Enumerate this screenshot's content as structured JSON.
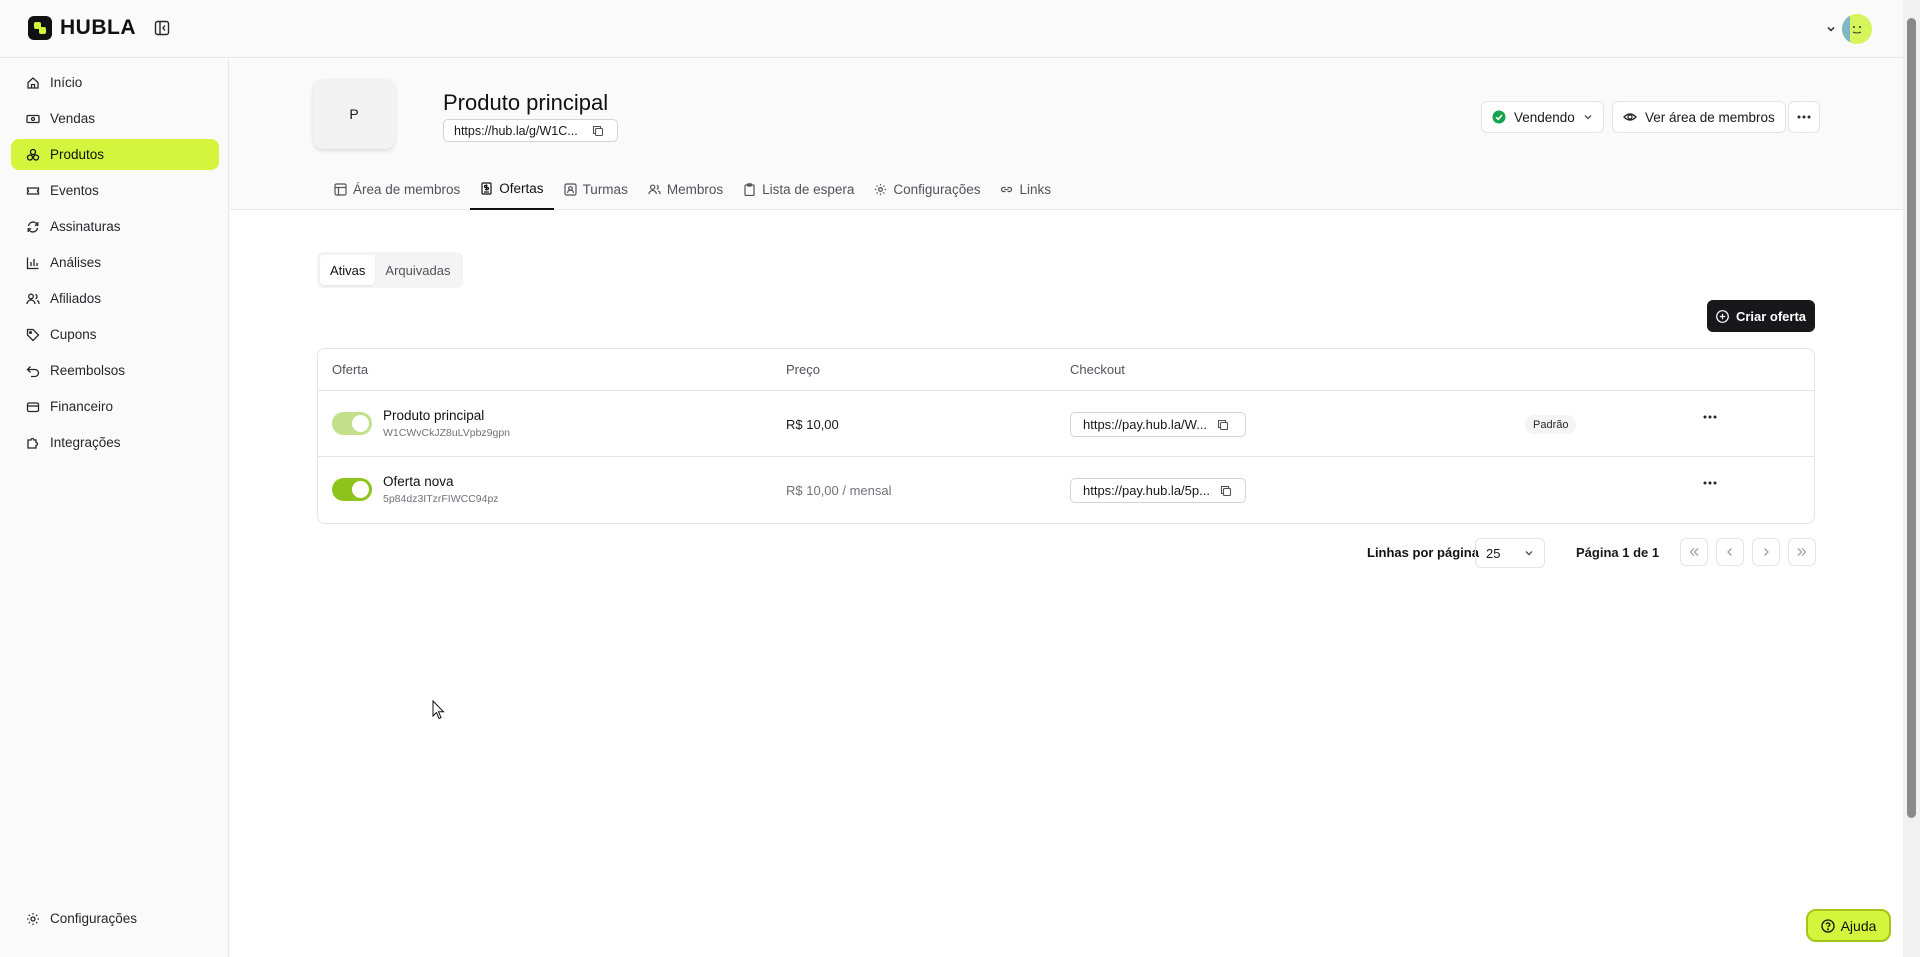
{
  "brand": {
    "name": "HUBLA",
    "accent": "#d4f53c"
  },
  "sidebar": {
    "items": [
      {
        "label": "Início",
        "icon": "home-icon"
      },
      {
        "label": "Vendas",
        "icon": "cash-icon"
      },
      {
        "label": "Produtos",
        "icon": "box-icon",
        "active": true
      },
      {
        "label": "Eventos",
        "icon": "ticket-icon"
      },
      {
        "label": "Assinaturas",
        "icon": "refresh-icon"
      },
      {
        "label": "Análises",
        "icon": "bar-chart-icon"
      },
      {
        "label": "Afiliados",
        "icon": "users-icon"
      },
      {
        "label": "Cupons",
        "icon": "tag-icon"
      },
      {
        "label": "Reembolsos",
        "icon": "undo-icon"
      },
      {
        "label": "Financeiro",
        "icon": "wallet-icon"
      },
      {
        "label": "Integrações",
        "icon": "puzzle-icon"
      }
    ],
    "footer_label": "Configurações"
  },
  "product": {
    "initial": "P",
    "title": "Produto principal",
    "link": "https://hub.la/g/W1C...",
    "status_label": "Vendendo",
    "members_button": "Ver área de membros"
  },
  "tabs": [
    {
      "label": "Área de membros",
      "icon": "layout-icon"
    },
    {
      "label": "Ofertas",
      "icon": "receipt-icon",
      "active": true
    },
    {
      "label": "Turmas",
      "icon": "id-card-icon"
    },
    {
      "label": "Membros",
      "icon": "users-icon"
    },
    {
      "label": "Lista de espera",
      "icon": "clipboard-icon"
    },
    {
      "label": "Configurações",
      "icon": "gear-icon"
    },
    {
      "label": "Links",
      "icon": "link-icon"
    }
  ],
  "filter": {
    "active": "Ativas",
    "archived": "Arquivadas"
  },
  "create_button": "Criar oferta",
  "table": {
    "headers": {
      "offer": "Oferta",
      "price": "Preço",
      "checkout": "Checkout"
    },
    "rows": [
      {
        "name": "Produto principal",
        "id": "W1CWvCkJZ8uLVpbz9gpn",
        "price": "R$ 10,00",
        "checkout": "https://pay.hub.la/W...",
        "badge": "Padrão",
        "enabled": true,
        "toggle_color": "#c2e08a"
      },
      {
        "name": "Oferta nova",
        "id": "5p84dz3ITzrFIWCC94pz",
        "price": "R$ 10,00 / mensal",
        "checkout": "https://pay.hub.la/5p...",
        "enabled": true,
        "toggle_color": "#8dc41c"
      }
    ]
  },
  "pagination": {
    "rows_label": "Linhas por página",
    "page_size": "25",
    "page_info": "Página 1 de 1"
  },
  "help_button": "Ajuda"
}
